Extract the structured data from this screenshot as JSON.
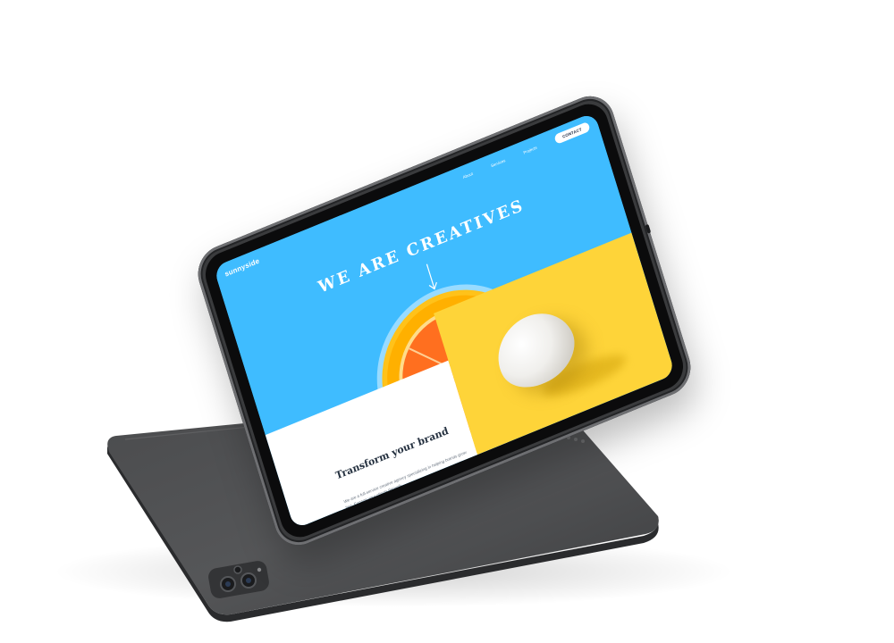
{
  "site": {
    "logo": "sunnyside",
    "nav": {
      "about": "About",
      "services": "Services",
      "projects": "Projects",
      "contact": "CONTACT"
    },
    "hero": {
      "title": "WE ARE CREATIVES"
    },
    "section": {
      "heading": "Transform your brand",
      "body": "We are a full-service creative agency specializing in helping brands grow fast. Engage your clients through"
    }
  },
  "colors": {
    "hero_blue": "#3fbcff",
    "yellow_panel": "#fed439",
    "heading_text": "#24303f",
    "device_body": "#3a3b3d"
  },
  "icons": {
    "hero_arrow": "arrow-down-icon",
    "back_camera": "camera-module-icon",
    "smart_connector": "smart-connector-icon"
  }
}
